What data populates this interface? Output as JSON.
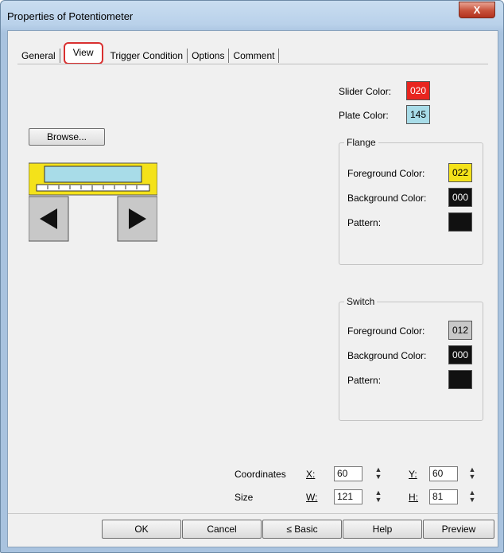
{
  "window": {
    "title": "Properties of Potentiometer",
    "close_label": "X"
  },
  "tabs": [
    {
      "label": "General"
    },
    {
      "label": "View"
    },
    {
      "label": "Trigger Condition"
    },
    {
      "label": "Options"
    },
    {
      "label": "Comment"
    }
  ],
  "browse_label": "Browse...",
  "slider_color": {
    "label": "Slider Color:",
    "value": "020",
    "color": "#e8251f"
  },
  "plate_color": {
    "label": "Plate Color:",
    "value": "145",
    "color": "#a8dce8"
  },
  "flange": {
    "title": "Flange",
    "foreground": {
      "label": "Foreground Color:",
      "value": "022",
      "color": "#f4e21a"
    },
    "background": {
      "label": "Background Color:",
      "value": "000",
      "color": "#111111"
    },
    "pattern": {
      "label": "Pattern:",
      "color": "#111111"
    }
  },
  "switch": {
    "title": "Switch",
    "foreground": {
      "label": "Foreground Color:",
      "value": "012",
      "color": "#c8c8c8"
    },
    "background": {
      "label": "Background Color:",
      "value": "000",
      "color": "#111111"
    },
    "pattern": {
      "label": "Pattern:",
      "color": "#111111"
    }
  },
  "coordinates": {
    "label": "Coordinates",
    "x_label": "X:",
    "x": "60",
    "y_label": "Y:",
    "y": "60"
  },
  "size": {
    "label": "Size",
    "w_label": "W:",
    "w": "121",
    "h_label": "H:",
    "h": "81"
  },
  "buttons": {
    "ok": "OK",
    "cancel": "Cancel",
    "basic": "≤ Basic",
    "help": "Help",
    "preview": "Preview"
  },
  "preview_colors": {
    "flange": "#f4e21a",
    "plate": "#a8dce8",
    "arrow_bg": "#c8c8c8"
  }
}
